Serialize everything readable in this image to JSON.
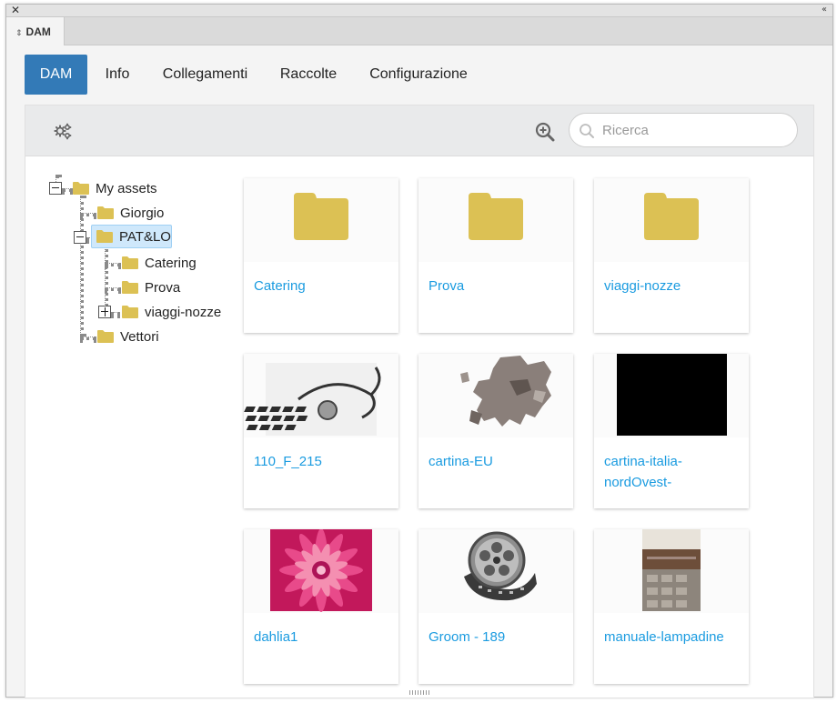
{
  "panel": {
    "tab_label": "DAM",
    "close_glyph": "✕",
    "collapse_glyph": "‹‹",
    "tab_glyph": "⌃⌄"
  },
  "nav": {
    "tabs": [
      {
        "label": "DAM",
        "active": true
      },
      {
        "label": "Info",
        "active": false
      },
      {
        "label": "Collegamenti",
        "active": false
      },
      {
        "label": "Raccolte",
        "active": false
      },
      {
        "label": "Configurazione",
        "active": false
      }
    ]
  },
  "toolbar": {
    "settings_icon": "gears-icon",
    "zoom_icon": "zoom-in-icon",
    "search_placeholder": "Ricerca",
    "search_value": ""
  },
  "tree": {
    "root": "My assets",
    "items": [
      "Giorgio",
      "PAT&LO",
      "Catering",
      "Prova",
      "viaggi-nozze",
      "Vettori"
    ],
    "selected": "PAT&LO"
  },
  "assets": [
    {
      "name": "Catering",
      "kind": "folder"
    },
    {
      "name": "Prova",
      "kind": "folder"
    },
    {
      "name": "viaggi-nozze",
      "kind": "folder"
    },
    {
      "name": "110_F_215",
      "kind": "image"
    },
    {
      "name": "cartina-EU",
      "kind": "image"
    },
    {
      "name": "cartina-italia-nordOvest-",
      "kind": "image"
    },
    {
      "name": "dahlia1",
      "kind": "image"
    },
    {
      "name": "Groom - 189",
      "kind": "image"
    },
    {
      "name": "manuale-lampadine",
      "kind": "image"
    }
  ],
  "colors": {
    "accent": "#337ab7",
    "link": "#1a9be0",
    "folder": "#dcc154",
    "selection": "#cfe8fb"
  }
}
